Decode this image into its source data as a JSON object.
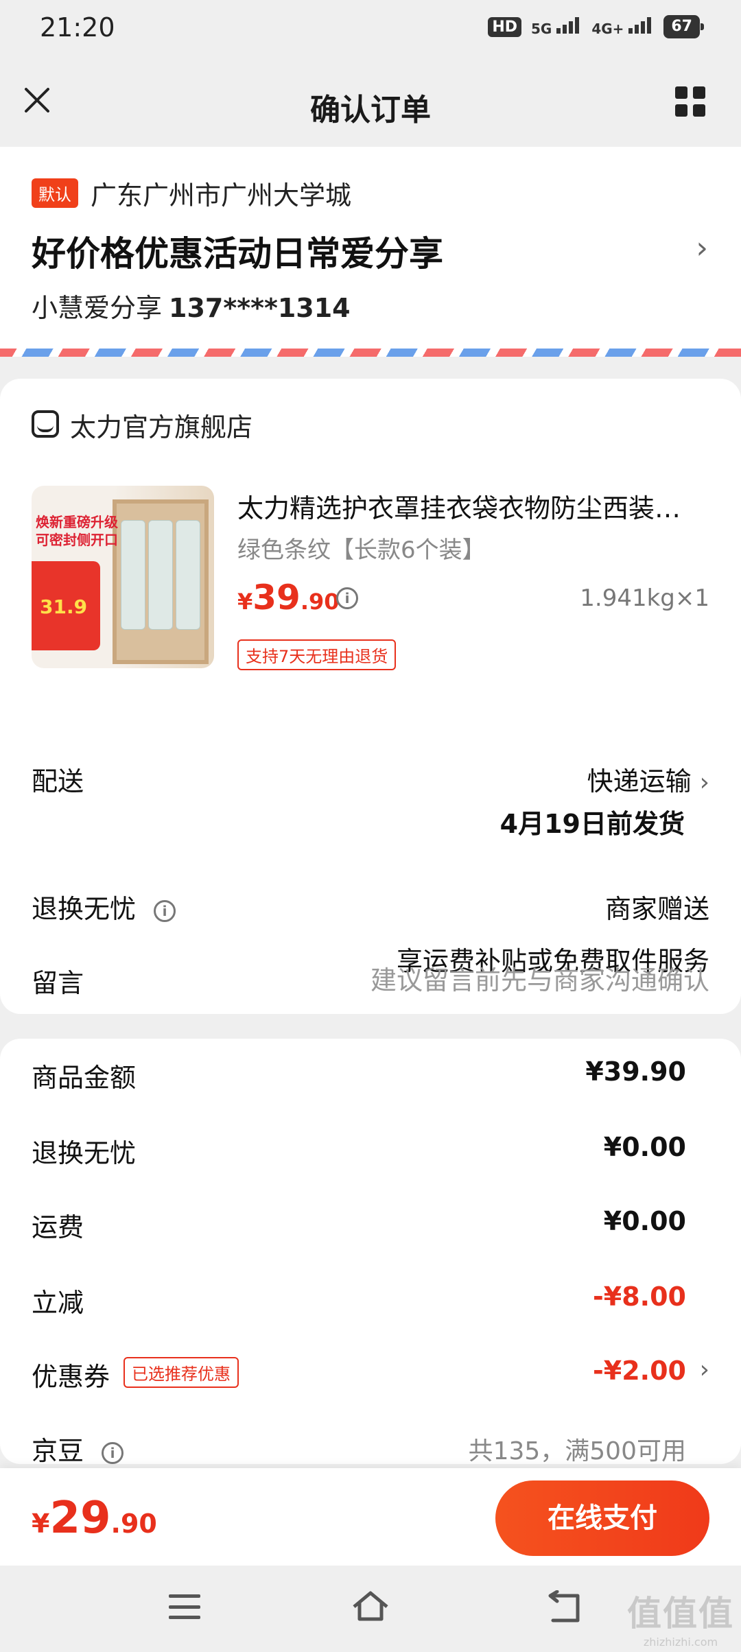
{
  "status_bar": {
    "time": "21:20",
    "hd": "HD",
    "net1": "5G",
    "net2": "4G+",
    "battery": "67"
  },
  "header": {
    "title": "确认订单"
  },
  "address": {
    "default_tag": "默认",
    "region": "广东广州市广州大学城",
    "detail": "好价格优惠活动日常爱分享",
    "name": "小慧爱分享",
    "phone": "137****1314"
  },
  "store": {
    "name": "太力官方旗舰店",
    "product": {
      "title": "太力精选护衣罩挂衣袋衣物防尘西装…",
      "spec": "绿色条纹【长款6个装】",
      "price_symbol": "¥",
      "price_int": "39",
      "price_dec": ".90",
      "weight_qty": "1.941kg×1",
      "return_tag": "支持7天无理由退货",
      "thumb_text1": "焕新重磅升级",
      "thumb_text2": "可密封侧开口",
      "thumb_price": "31.9"
    },
    "delivery": {
      "label": "配送",
      "method": "快递运输",
      "ship_date": "4月19日前发货"
    },
    "return_worry": {
      "label": "退换无忧",
      "value": "商家赠送",
      "desc": "享运费补贴或免费取件服务"
    },
    "message": {
      "label": "留言",
      "placeholder": "建议留言前先与商家沟通确认"
    }
  },
  "summary": {
    "rows": [
      {
        "label": "商品金额",
        "value": "¥39.90"
      },
      {
        "label": "退换无忧",
        "value": "¥0.00"
      },
      {
        "label": "运费",
        "value": "¥0.00"
      },
      {
        "label": "立减",
        "value": "-¥8.00"
      },
      {
        "label": "优惠券",
        "value": "-¥2.00",
        "tag": "已选推荐优惠"
      },
      {
        "label": "京豆",
        "value": "共135，满500可用"
      }
    ]
  },
  "paybar": {
    "symbol": "¥",
    "total_int": "29",
    "total_dec": ".90",
    "pay_label": "在线支付"
  },
  "watermark": {
    "big": "值值值",
    "small": "zhizhizhi.com"
  },
  "colors": {
    "accent": "#e8301c",
    "background": "#efefef"
  },
  "icons": [
    "close-icon",
    "grid-icon",
    "chevron-right-icon",
    "store-icon",
    "info-icon",
    "menu-icon",
    "home-icon",
    "back-icon"
  ]
}
